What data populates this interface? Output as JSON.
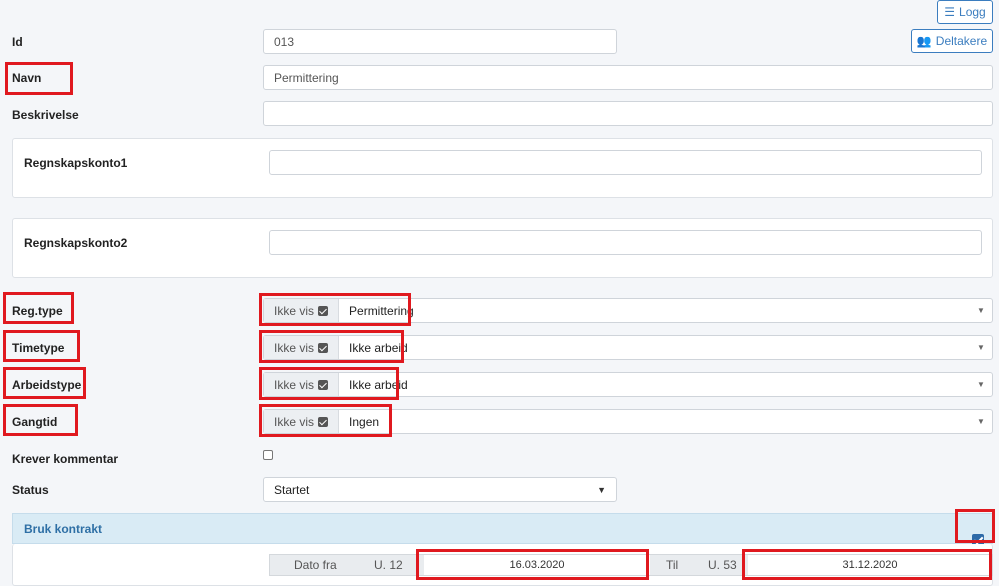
{
  "toolbar": {
    "logg_label": "Logg",
    "deltakere_label": "Deltakere"
  },
  "fields": {
    "id": {
      "label": "Id",
      "value": "013"
    },
    "navn": {
      "label": "Navn",
      "value": "Permittering"
    },
    "beskrivelse": {
      "label": "Beskrivelse",
      "value": ""
    },
    "regnskapskonto1": {
      "label": "Regnskapskonto1",
      "value": ""
    },
    "regnskapskonto2": {
      "label": "Regnskapskonto2",
      "value": ""
    },
    "regtype": {
      "label": "Reg.type",
      "addon": "Ikke vis",
      "value": "Permittering",
      "hidden_checked": true
    },
    "timetype": {
      "label": "Timetype",
      "addon": "Ikke vis",
      "value": "Ikke arbeid",
      "hidden_checked": true
    },
    "arbeidstype": {
      "label": "Arbeidstype",
      "addon": "Ikke vis",
      "value": "Ikke arbeid",
      "hidden_checked": true
    },
    "gangtid": {
      "label": "Gangtid",
      "addon": "Ikke vis",
      "value": "Ingen",
      "hidden_checked": true
    },
    "krever_kommentar": {
      "label": "Krever kommentar",
      "checked": false
    },
    "status": {
      "label": "Status",
      "value": "Startet",
      "options": [
        "Startet"
      ]
    }
  },
  "contract": {
    "title": "Bruk kontrakt",
    "enabled": true,
    "date_from_label": "Dato fra",
    "from_week": "U. 12",
    "from_date": "16.03.2020",
    "to_label": "Til",
    "to_week": "U. 53",
    "to_date": "31.12.2020"
  },
  "colors": {
    "accent": "#3b7dbf",
    "highlight": "#e0191f",
    "panel": "#d9ebf5"
  }
}
